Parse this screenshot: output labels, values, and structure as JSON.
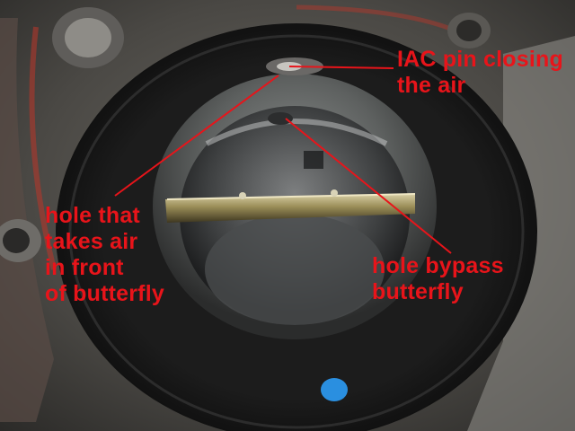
{
  "photo": {
    "subject": "throttle body bore with butterfly valve",
    "annotation_color": "#e8141a",
    "marker_color": "#2a8fe0"
  },
  "annotations": {
    "iac": {
      "line1": "IAC pin closing",
      "line2": "the air"
    },
    "hole_air": {
      "line1": "hole that",
      "line2": "takes air",
      "line3": "in front",
      "line4": "of butterfly"
    },
    "bypass": {
      "line1": "hole bypass",
      "line2": "butterfly"
    }
  }
}
